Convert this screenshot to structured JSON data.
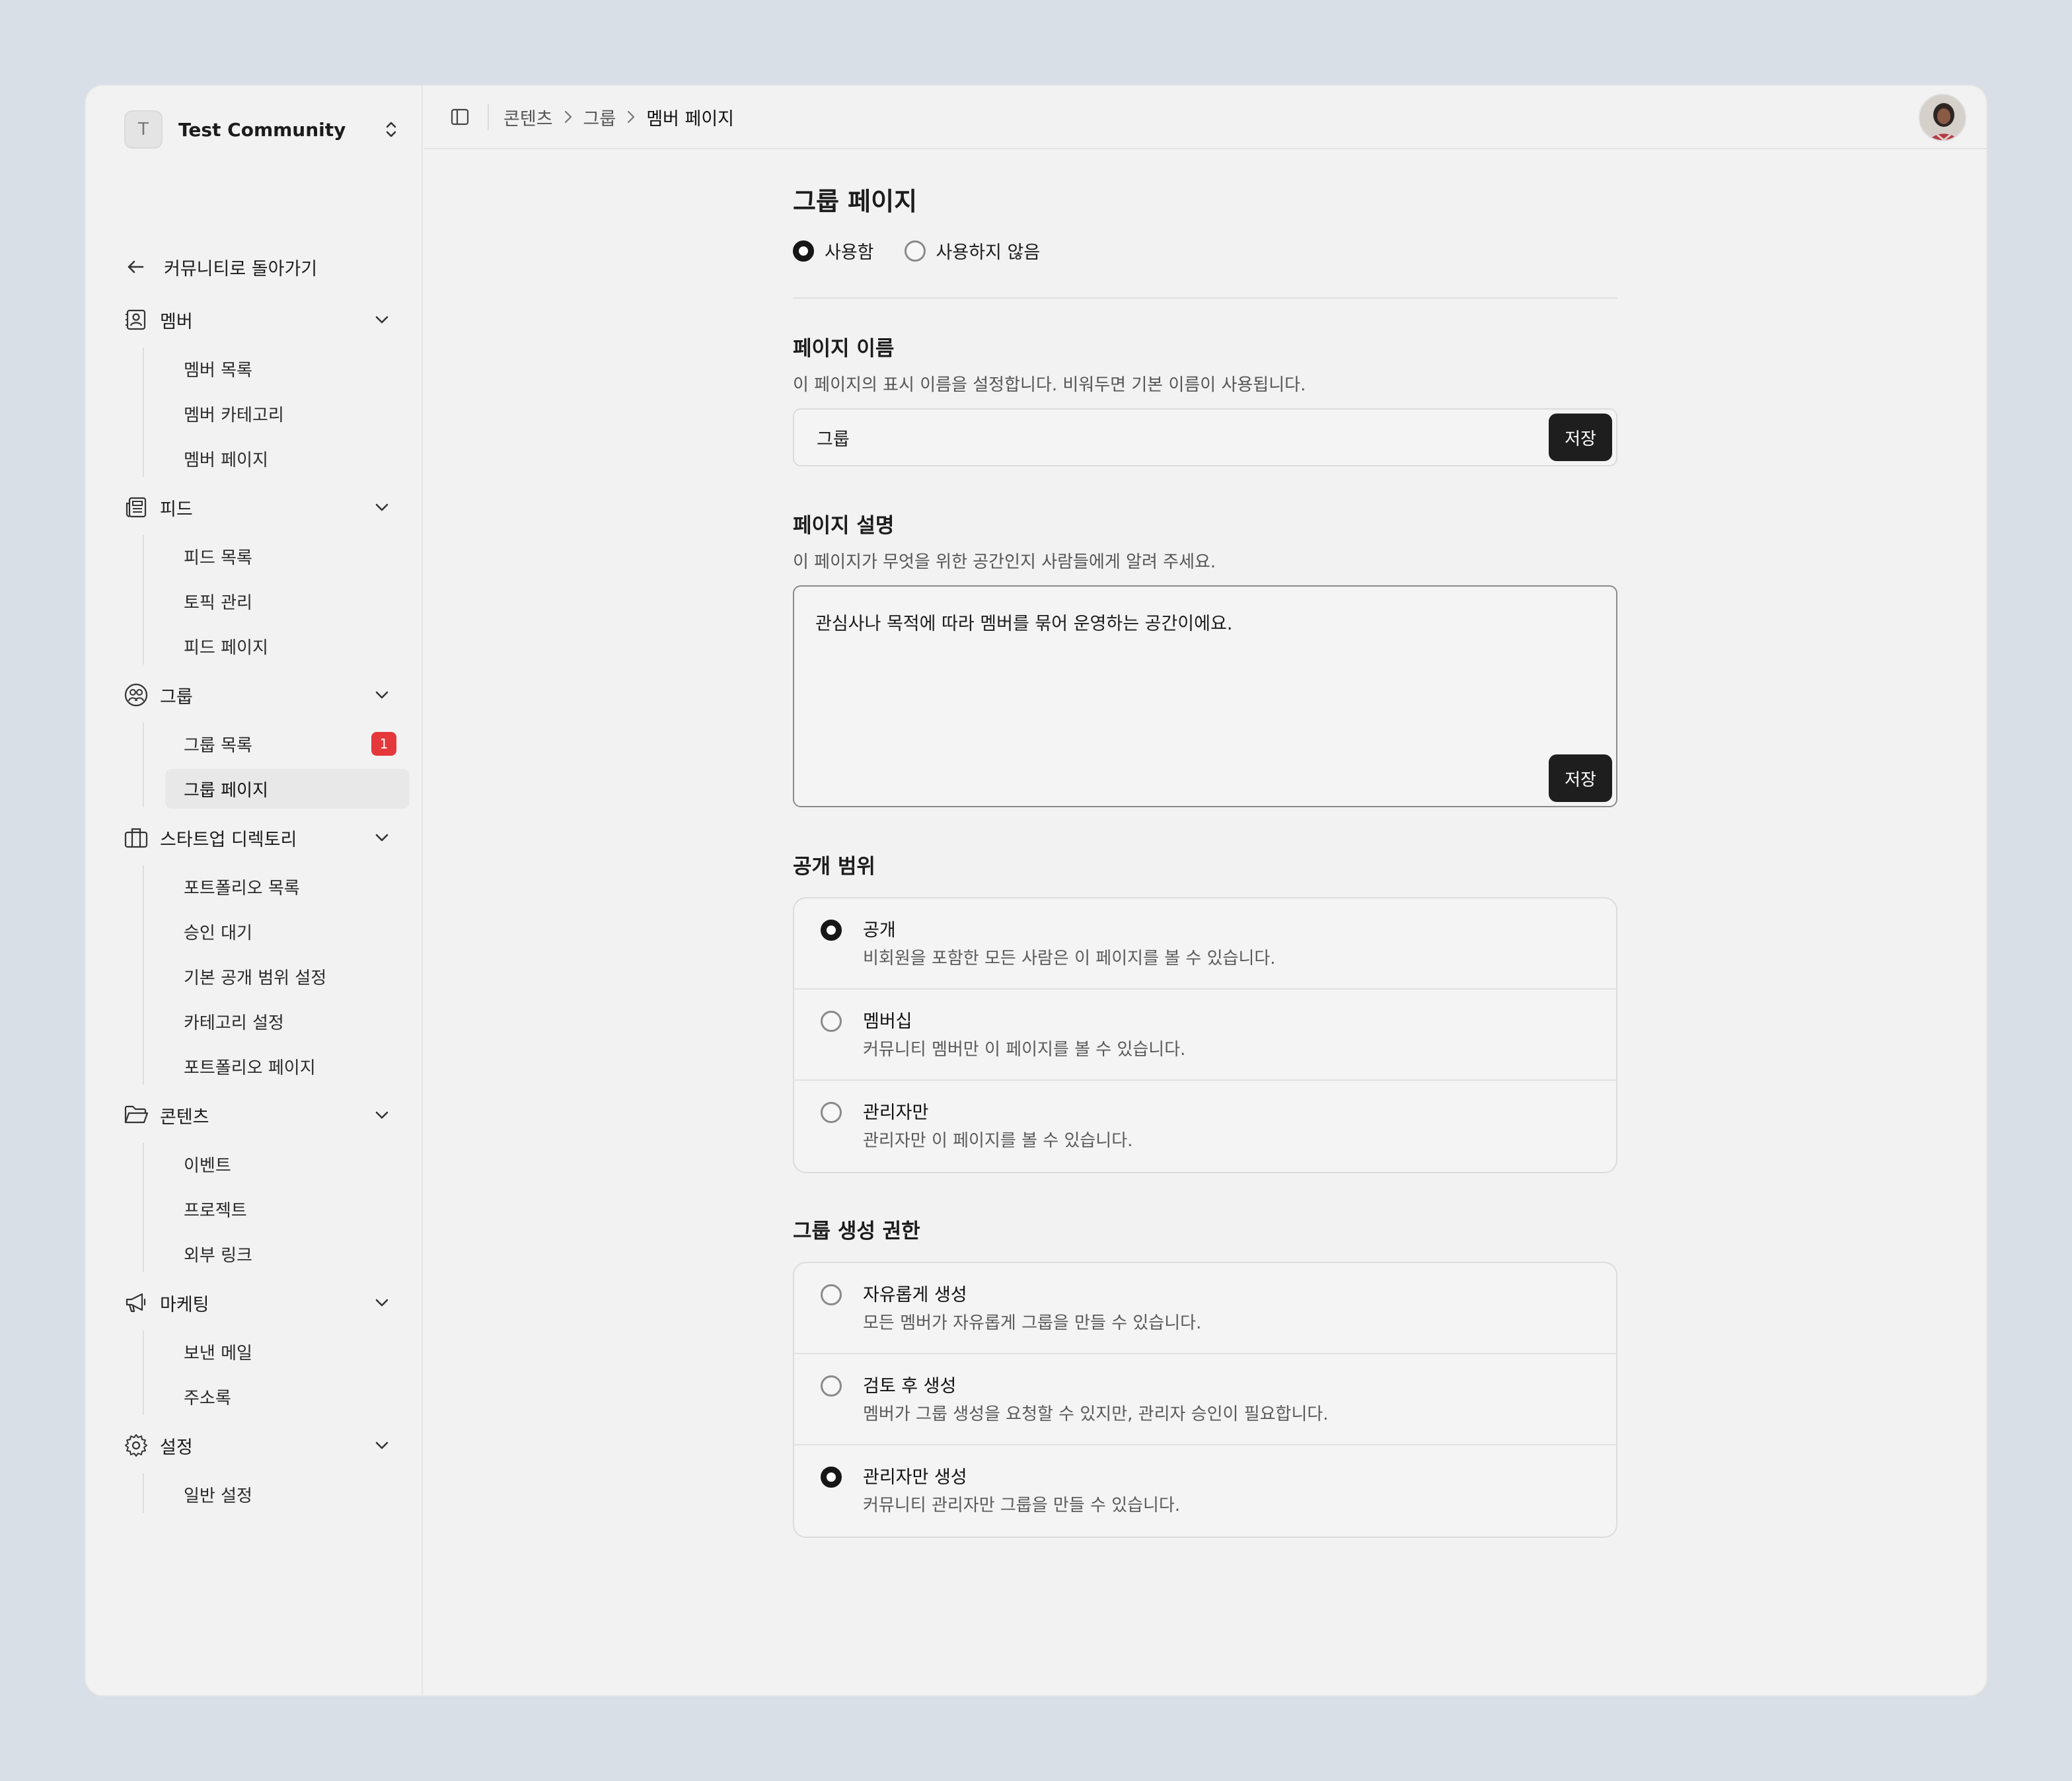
{
  "workspace": {
    "initial": "T",
    "name": "Test Community"
  },
  "sidebar": {
    "back_label": "커뮤니티로 돌아가기",
    "groups": [
      {
        "label": "멤버",
        "icon": "member-card-icon",
        "items": [
          {
            "label": "멤버 목록"
          },
          {
            "label": "멤버 카테고리"
          },
          {
            "label": "멤버 페이지"
          }
        ]
      },
      {
        "label": "피드",
        "icon": "newspaper-icon",
        "items": [
          {
            "label": "피드 목록"
          },
          {
            "label": "토픽 관리"
          },
          {
            "label": "피드 페이지"
          }
        ]
      },
      {
        "label": "그룹",
        "icon": "group-icon",
        "items": [
          {
            "label": "그룹 목록",
            "badge": "1"
          },
          {
            "label": "그룹 페이지",
            "active": true
          }
        ]
      },
      {
        "label": "스타트업 디렉토리",
        "icon": "briefcase-icon",
        "items": [
          {
            "label": "포트폴리오 목록"
          },
          {
            "label": "승인 대기"
          },
          {
            "label": "기본 공개 범위 설정"
          },
          {
            "label": "카테고리 설정"
          },
          {
            "label": "포트폴리오 페이지"
          }
        ]
      },
      {
        "label": "콘텐츠",
        "icon": "folder-icon",
        "items": [
          {
            "label": "이벤트"
          },
          {
            "label": "프로젝트"
          },
          {
            "label": "외부 링크"
          }
        ]
      },
      {
        "label": "마케팅",
        "icon": "megaphone-icon",
        "items": [
          {
            "label": "보낸 메일"
          },
          {
            "label": "주소록"
          }
        ]
      },
      {
        "label": "설정",
        "icon": "gear-icon",
        "items": [
          {
            "label": "일반 설정"
          }
        ]
      }
    ]
  },
  "breadcrumb": [
    "콘텐츠",
    "그룹",
    "멤버 페이지"
  ],
  "page": {
    "title": "그룹 페이지",
    "enable": {
      "on_label": "사용함",
      "off_label": "사용하지 않음",
      "selected": "on"
    },
    "name_section": {
      "title": "페이지 이름",
      "desc": "이 페이지의 표시 이름을 설정합니다. 비워두면 기본 이름이 사용됩니다.",
      "value": "그룹",
      "save_label": "저장"
    },
    "desc_section": {
      "title": "페이지 설명",
      "desc": "이 페이지가 무엇을 위한 공간인지 사람들에게 알려 주세요.",
      "value": "관심사나 목적에 따라 멤버를 묶어 운영하는 공간이에요.",
      "save_label": "저장"
    },
    "visibility": {
      "title": "공개 범위",
      "options": [
        {
          "title": "공개",
          "desc": "비회원을 포함한 모든 사람은 이 페이지를 볼 수 있습니다.",
          "selected": true
        },
        {
          "title": "멤버십",
          "desc": "커뮤니티 멤버만 이 페이지를 볼 수 있습니다.",
          "selected": false
        },
        {
          "title": "관리자만",
          "desc": "관리자만 이 페이지를 볼 수 있습니다.",
          "selected": false
        }
      ]
    },
    "creation": {
      "title": "그룹 생성 권한",
      "options": [
        {
          "title": "자유롭게 생성",
          "desc": "모든 멤버가 자유롭게 그룹을 만들 수 있습니다.",
          "selected": false
        },
        {
          "title": "검토 후 생성",
          "desc": "멤버가 그룹 생성을 요청할 수 있지만, 관리자 승인이 필요합니다.",
          "selected": false
        },
        {
          "title": "관리자만 생성",
          "desc": "커뮤니티 관리자만 그룹을 만들 수 있습니다.",
          "selected": true
        }
      ]
    }
  }
}
